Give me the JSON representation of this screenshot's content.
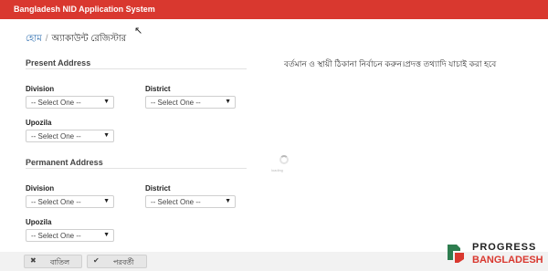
{
  "app": {
    "title": "Bangladesh NID Application System"
  },
  "breadcrumb": {
    "home": "হোম",
    "separator": "/",
    "current": "অ্যাকাউন্ট রেজিস্টার"
  },
  "info_text": "বর্তমান ও স্থায়ী ঠিকানা নির্বাচন করুন।প্রদত্ত তথ্যাদি যাচাই করা হবে",
  "present_address": {
    "heading": "Present Address",
    "division": {
      "label": "Division",
      "selected": "-- Select One --"
    },
    "district": {
      "label": "District",
      "selected": "-- Select One --"
    },
    "upozila": {
      "label": "Upozila",
      "selected": "-- Select One --"
    }
  },
  "permanent_address": {
    "heading": "Permanent Address",
    "division": {
      "label": "Division",
      "selected": "-- Select One --"
    },
    "district": {
      "label": "District",
      "selected": "-- Select One --"
    },
    "upozila": {
      "label": "Upozila",
      "selected": "-- Select One --"
    }
  },
  "loading": {
    "label": "loading"
  },
  "buttons": {
    "cancel": {
      "label": "বাতিল",
      "icon": "close-icon"
    },
    "next": {
      "label": "পরবর্তী",
      "icon": "check-icon"
    }
  },
  "brand": {
    "line1": "PROGRESS",
    "line2": "BANGLADESH"
  },
  "colors": {
    "header": "#d9382f",
    "link": "#2f6fb0",
    "brand_red": "#d9382f",
    "brand_green": "#2e7d4f"
  }
}
